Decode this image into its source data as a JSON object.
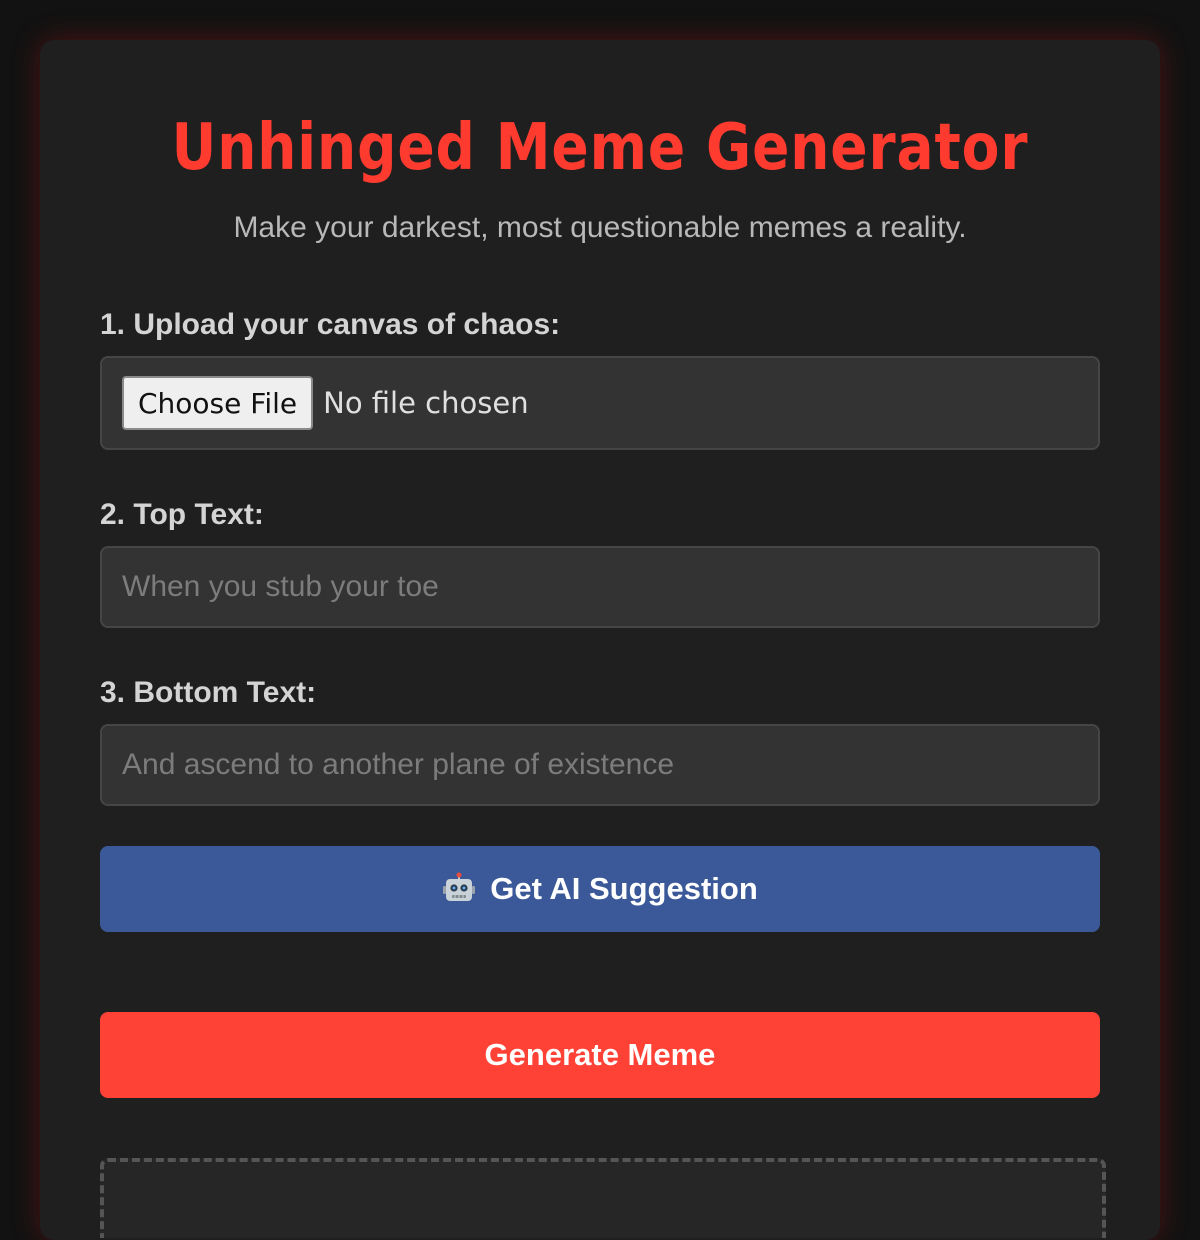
{
  "header": {
    "title": "Unhinged Meme Generator",
    "subtitle": "Make your darkest, most questionable memes a reality."
  },
  "upload": {
    "label": "1. Upload your canvas of chaos:",
    "button_label": "Choose File",
    "status": "No file chosen"
  },
  "top_text": {
    "label": "2. Top Text:",
    "value": "",
    "placeholder": "When you stub your toe"
  },
  "bottom_text": {
    "label": "3. Bottom Text:",
    "value": "",
    "placeholder": "And ascend to another plane of existence"
  },
  "ai_button": {
    "icon": "robot-icon",
    "label": "Get AI Suggestion"
  },
  "generate_button": {
    "label": "Generate Meme"
  },
  "colors": {
    "accent": "#ff3b30",
    "ai_button": "#3b5998",
    "generate_button": "#ff4136",
    "card_background": "#1f1f1f",
    "page_background": "#121212"
  }
}
